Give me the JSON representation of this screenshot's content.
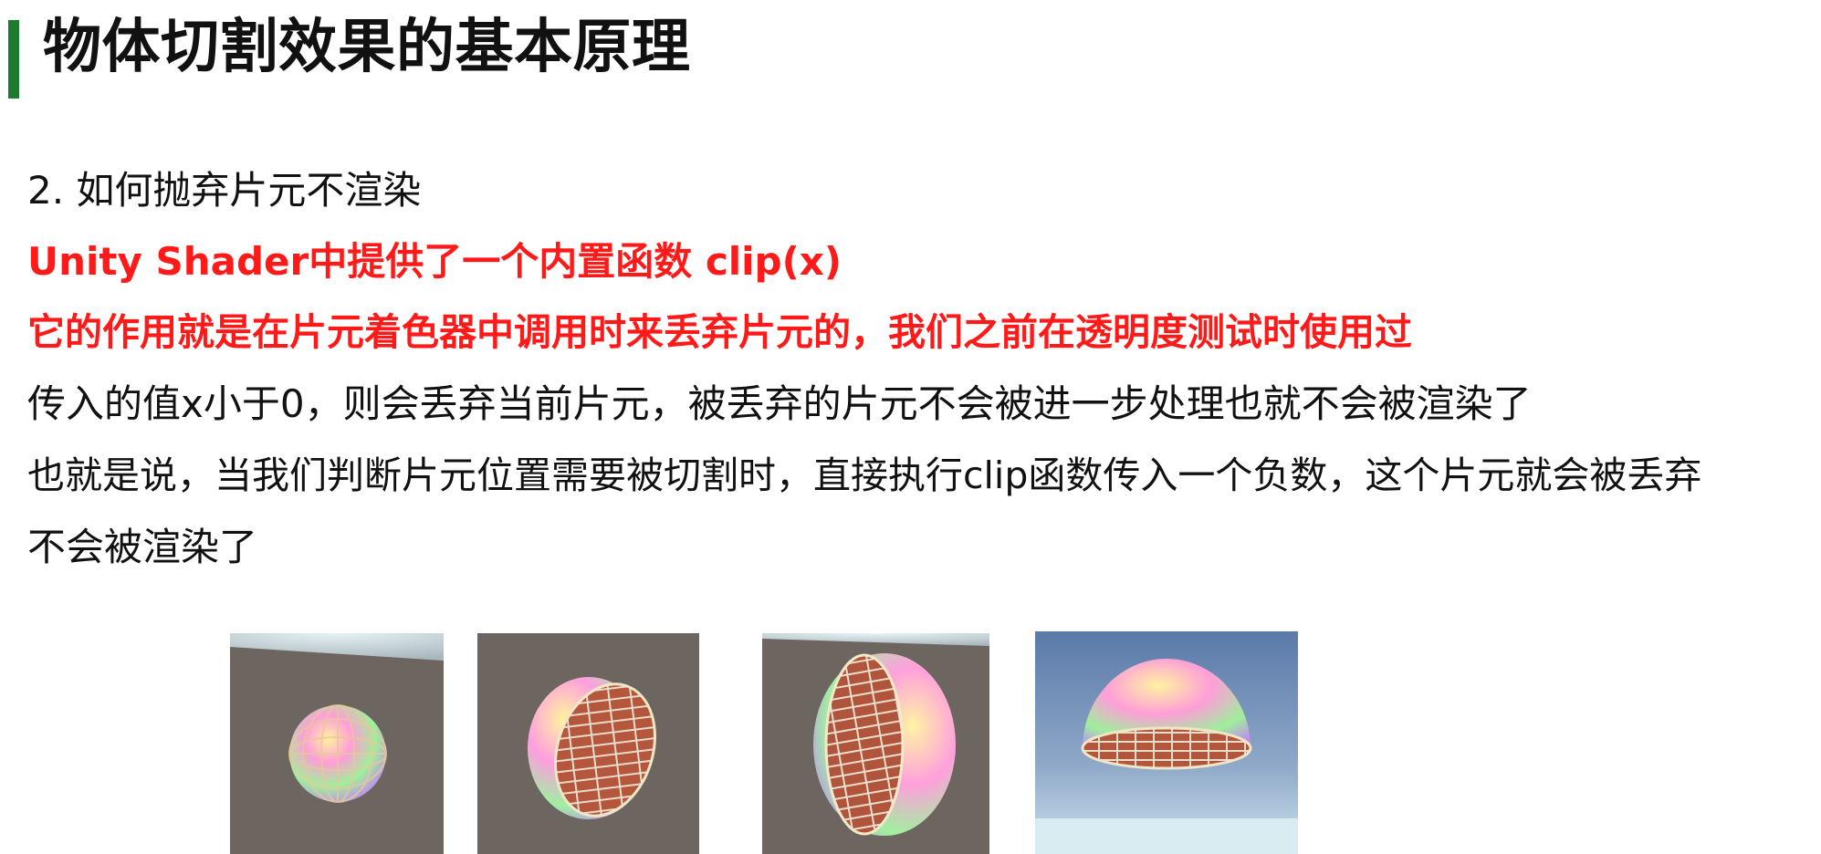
{
  "slide": {
    "title": "物体切割效果的基本原理",
    "lines": [
      "2. 如何抛弃片元不渲染",
      "Unity Shader中提供了一个内置函数 clip(x)",
      "它的作用就是在片元着色器中调用时来丢弃片元的，我们之前在透明度测试时使用过",
      "传入的值x小于0，则会丢弃当前片元，被丢弃的片元不会被进一步处理也就不会被渲染了",
      "也就是说，当我们判断片元位置需要被切割时，直接执行clip函数传入一个负数，这个片元就会被丢弃",
      "不会被渲染了"
    ]
  },
  "colors": {
    "accent_bar": "#1e7a2e",
    "highlight_text": "#ff1a1a",
    "body_text": "#111111"
  }
}
